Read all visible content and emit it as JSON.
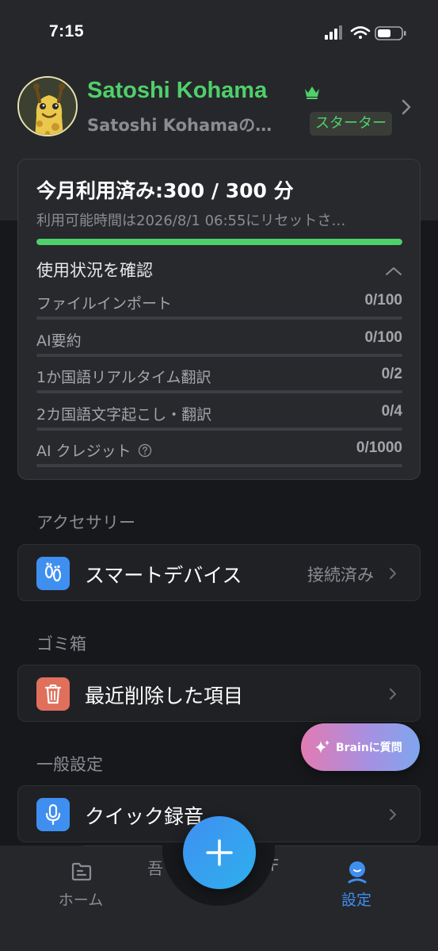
{
  "status_bar": {
    "time": "7:15"
  },
  "profile": {
    "name": "Satoshi Kohama",
    "subtitle": "Satoshi Kohamaの…",
    "plan_badge": "スターター"
  },
  "usage": {
    "title": "今月利用済み:300 / 300 分",
    "reset_note": "利用可能時間は2026/8/1 06:55にリセットさ…",
    "progress_fraction": 1.0,
    "section_label": "使用状況を確認",
    "rows": [
      {
        "label": "ファイルインポート",
        "value": "0/100"
      },
      {
        "label": "AI要約",
        "value": "0/100"
      },
      {
        "label": "1か国語リアルタイム翻訳",
        "value": "0/2"
      },
      {
        "label": "2カ国語文字起こし・翻訳",
        "value": "0/4"
      },
      {
        "label": "AI クレジット",
        "value": "0/1000"
      }
    ]
  },
  "accessories": {
    "header": "アクセサリー",
    "smart_device": {
      "label": "スマートデバイス",
      "value": "接続済み"
    }
  },
  "trash": {
    "header": "ゴミ箱",
    "recently_deleted": {
      "label": "最近削除した項目"
    }
  },
  "general": {
    "header": "一般設定",
    "quick_record": {
      "label": "クイック録音"
    }
  },
  "brain_button": {
    "label": "Brainに質問"
  },
  "nav": {
    "home": "ホーム",
    "clip_left": "吾",
    "clip_right": "F",
    "settings": "設定"
  },
  "colors": {
    "accent_green": "#4fd06a",
    "accent_blue": "#3f8ff0",
    "background": "#17181b",
    "card": "#28292d",
    "trash_icon": "#e0705c"
  }
}
